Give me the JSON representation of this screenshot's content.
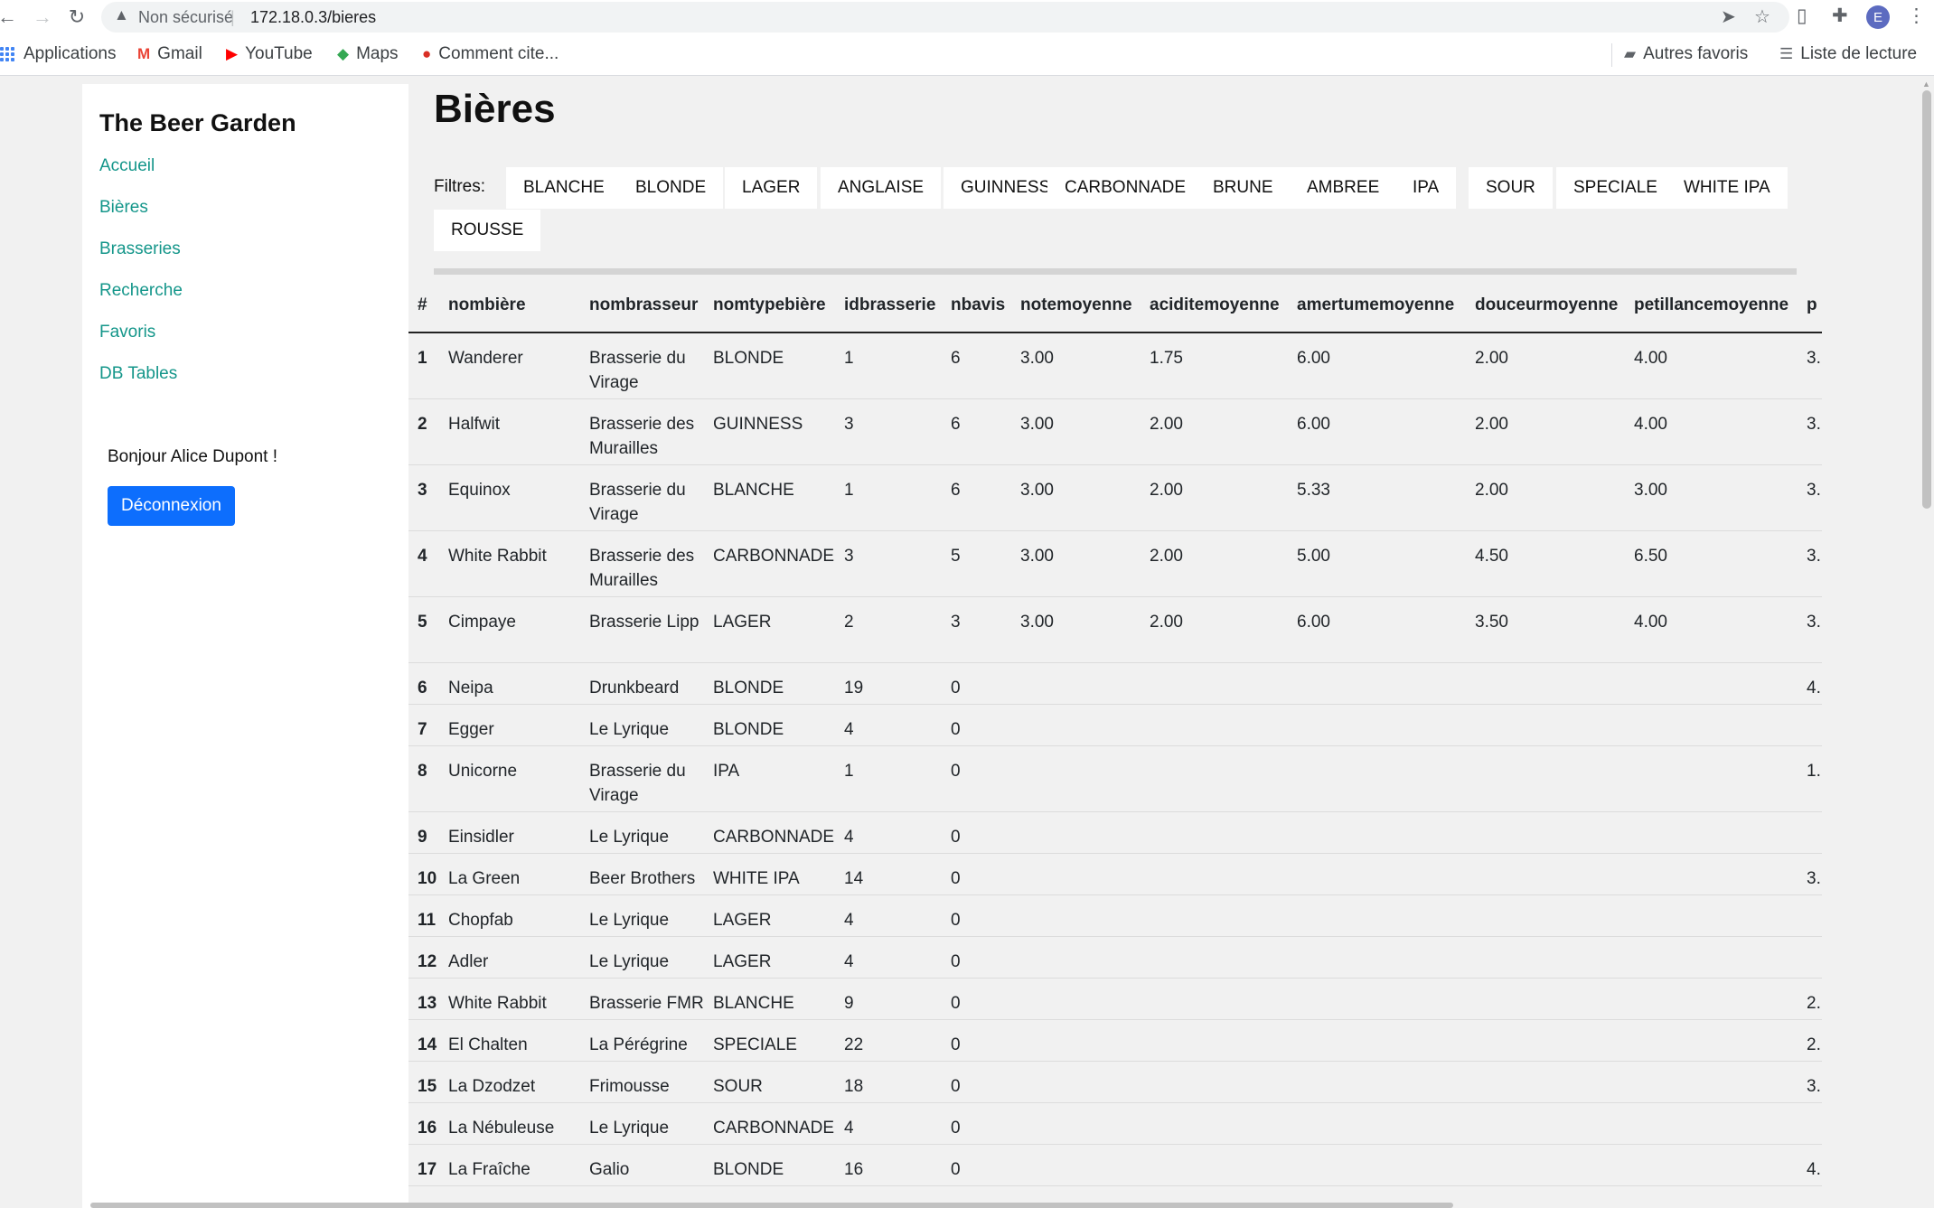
{
  "browser": {
    "security_label": "Non sécurisé",
    "separator": "|",
    "url": "172.18.0.3/bieres",
    "profile_initial": "E",
    "bookmarks": {
      "apps": "Applications",
      "gmail": "Gmail",
      "youtube": "YouTube",
      "maps": "Maps",
      "comment": "Comment cite...",
      "other_favorites": "Autres favoris",
      "reading_list": "Liste de lecture"
    }
  },
  "sidebar": {
    "title": "The Beer Garden",
    "nav": [
      "Accueil",
      "Bières",
      "Brasseries",
      "Recherche",
      "Favoris",
      "DB Tables"
    ],
    "greeting": "Bonjour Alice Dupont !",
    "logout_label": "Déconnexion"
  },
  "main": {
    "title": "Bières",
    "filters_label": "Filtres:",
    "filters": [
      "BLANCHE",
      "BLONDE",
      "LAGER",
      "ANGLAISE",
      "GUINNESS",
      "CARBONNADE",
      "BRUNE",
      "AMBREE",
      "IPA",
      "SOUR",
      "SPECIALE",
      "WHITE IPA",
      "ROUSSE"
    ]
  },
  "table": {
    "headers": [
      "#",
      "nombière",
      "nombrasseur",
      "nomtypebière",
      "idbrasserie",
      "nbavis",
      "notemoyenne",
      "aciditemoyenne",
      "amertumemoyenne",
      "douceurmoyenne",
      "petillancemoyenne",
      "p"
    ],
    "rows": [
      [
        "1",
        "Wanderer",
        "Brasserie du Virage",
        "BLONDE",
        "1",
        "6",
        "3.00",
        "1.75",
        "6.00",
        "2.00",
        "4.00",
        "3."
      ],
      [
        "2",
        "Halfwit",
        "Brasserie des Murailles",
        "GUINNESS",
        "3",
        "6",
        "3.00",
        "2.00",
        "6.00",
        "2.00",
        "4.00",
        "3."
      ],
      [
        "3",
        "Equinox",
        "Brasserie du Virage",
        "BLANCHE",
        "1",
        "6",
        "3.00",
        "2.00",
        "5.33",
        "2.00",
        "3.00",
        "3."
      ],
      [
        "4",
        "White Rabbit",
        "Brasserie des Murailles",
        "CARBONNADE",
        "3",
        "5",
        "3.00",
        "2.00",
        "5.00",
        "4.50",
        "6.50",
        "3."
      ],
      [
        "5",
        "Cimpaye",
        "Brasserie Lipp",
        "LAGER",
        "2",
        "3",
        "3.00",
        "2.00",
        "6.00",
        "3.50",
        "4.00",
        "3."
      ],
      [
        "6",
        "Neipa",
        "Drunkbeard",
        "BLONDE",
        "19",
        "0",
        "",
        "",
        "",
        "",
        "",
        "4."
      ],
      [
        "7",
        "Egger",
        "Le Lyrique",
        "BLONDE",
        "4",
        "0",
        "",
        "",
        "",
        "",
        "",
        ""
      ],
      [
        "8",
        "Unicorne",
        "Brasserie du Virage",
        "IPA",
        "1",
        "0",
        "",
        "",
        "",
        "",
        "",
        "1."
      ],
      [
        "9",
        "Einsidler",
        "Le Lyrique",
        "CARBONNADE",
        "4",
        "0",
        "",
        "",
        "",
        "",
        "",
        ""
      ],
      [
        "10",
        "La Green",
        "Beer Brothers",
        "WHITE IPA",
        "14",
        "0",
        "",
        "",
        "",
        "",
        "",
        "3."
      ],
      [
        "11",
        "Chopfab",
        "Le Lyrique",
        "LAGER",
        "4",
        "0",
        "",
        "",
        "",
        "",
        "",
        ""
      ],
      [
        "12",
        "Adler",
        "Le Lyrique",
        "LAGER",
        "4",
        "0",
        "",
        "",
        "",
        "",
        "",
        ""
      ],
      [
        "13",
        "White Rabbit",
        "Brasserie FMR",
        "BLANCHE",
        "9",
        "0",
        "",
        "",
        "",
        "",
        "",
        "2."
      ],
      [
        "14",
        "El Chalten",
        "La Pérégrine",
        "SPECIALE",
        "22",
        "0",
        "",
        "",
        "",
        "",
        "",
        "2."
      ],
      [
        "15",
        "La Dzodzet",
        "Frimousse",
        "SOUR",
        "18",
        "0",
        "",
        "",
        "",
        "",
        "",
        "3."
      ],
      [
        "16",
        "La Nébuleuse",
        "Le Lyrique",
        "CARBONNADE",
        "4",
        "0",
        "",
        "",
        "",
        "",
        "",
        ""
      ],
      [
        "17",
        "La Fraîche",
        "Galio",
        "BLONDE",
        "16",
        "0",
        "",
        "",
        "",
        "",
        "",
        "4."
      ]
    ]
  },
  "colors": {
    "link": "#14968a",
    "primary_button": "#0d6efd",
    "page_background": "#f1f1f1"
  }
}
